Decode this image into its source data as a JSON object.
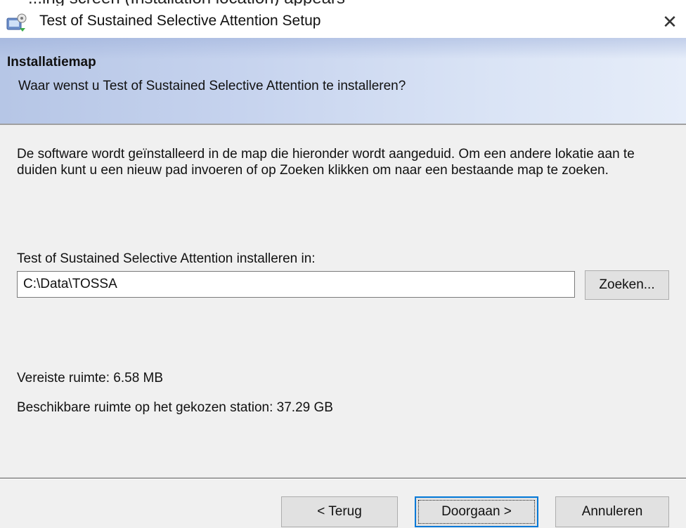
{
  "caption_above": "...ing screen (Installation location) appears",
  "window": {
    "title": "Test of Sustained Selective Attention Setup",
    "close_glyph": "✕"
  },
  "banner": {
    "title": "Installatiemap",
    "subtitle": "Waar wenst u Test of Sustained Selective Attention te installeren?"
  },
  "body": {
    "description": "De software wordt geïnstalleerd in de map die hieronder wordt aangeduid. Om een andere lokatie aan te duiden kunt u een nieuw pad invoeren of op Zoeken klikken om naar een bestaande map te zoeken.",
    "install_label": "Test of Sustained Selective Attention installeren in:",
    "path_value": "C:\\Data\\TOSSA",
    "browse_label": "Zoeken...",
    "required_space": "Vereiste ruimte: 6.58 MB",
    "available_space": "Beschikbare ruimte op het gekozen station: 37.29 GB"
  },
  "footer": {
    "back_label": "< Terug",
    "next_label": "Doorgaan >",
    "cancel_label": "Annuleren"
  },
  "icons": {
    "app_icon": "setup-installer-icon",
    "close_icon": "close-icon"
  },
  "colors": {
    "banner_left": "#b6c6e6",
    "banner_right": "#e6edf9",
    "focus_border": "#0078d7",
    "button_face": "#e1e1e1",
    "dialog_bg": "#f0f0f0"
  }
}
